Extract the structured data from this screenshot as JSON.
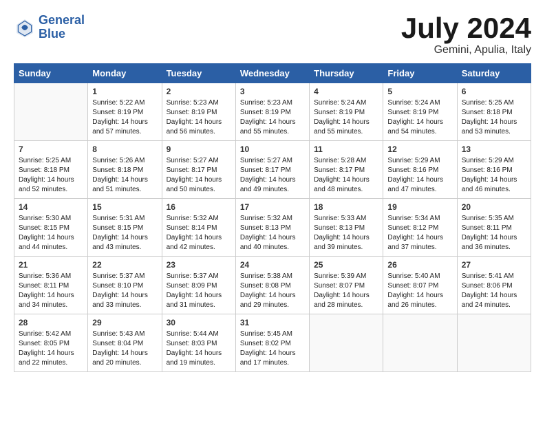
{
  "logo": {
    "text_general": "General",
    "text_blue": "Blue"
  },
  "header": {
    "month": "July 2024",
    "location": "Gemini, Apulia, Italy"
  },
  "weekdays": [
    "Sunday",
    "Monday",
    "Tuesday",
    "Wednesday",
    "Thursday",
    "Friday",
    "Saturday"
  ],
  "weeks": [
    [
      {
        "day": "",
        "info": ""
      },
      {
        "day": "1",
        "info": "Sunrise: 5:22 AM\nSunset: 8:19 PM\nDaylight: 14 hours\nand 57 minutes."
      },
      {
        "day": "2",
        "info": "Sunrise: 5:23 AM\nSunset: 8:19 PM\nDaylight: 14 hours\nand 56 minutes."
      },
      {
        "day": "3",
        "info": "Sunrise: 5:23 AM\nSunset: 8:19 PM\nDaylight: 14 hours\nand 55 minutes."
      },
      {
        "day": "4",
        "info": "Sunrise: 5:24 AM\nSunset: 8:19 PM\nDaylight: 14 hours\nand 55 minutes."
      },
      {
        "day": "5",
        "info": "Sunrise: 5:24 AM\nSunset: 8:19 PM\nDaylight: 14 hours\nand 54 minutes."
      },
      {
        "day": "6",
        "info": "Sunrise: 5:25 AM\nSunset: 8:18 PM\nDaylight: 14 hours\nand 53 minutes."
      }
    ],
    [
      {
        "day": "7",
        "info": "Sunrise: 5:25 AM\nSunset: 8:18 PM\nDaylight: 14 hours\nand 52 minutes."
      },
      {
        "day": "8",
        "info": "Sunrise: 5:26 AM\nSunset: 8:18 PM\nDaylight: 14 hours\nand 51 minutes."
      },
      {
        "day": "9",
        "info": "Sunrise: 5:27 AM\nSunset: 8:17 PM\nDaylight: 14 hours\nand 50 minutes."
      },
      {
        "day": "10",
        "info": "Sunrise: 5:27 AM\nSunset: 8:17 PM\nDaylight: 14 hours\nand 49 minutes."
      },
      {
        "day": "11",
        "info": "Sunrise: 5:28 AM\nSunset: 8:17 PM\nDaylight: 14 hours\nand 48 minutes."
      },
      {
        "day": "12",
        "info": "Sunrise: 5:29 AM\nSunset: 8:16 PM\nDaylight: 14 hours\nand 47 minutes."
      },
      {
        "day": "13",
        "info": "Sunrise: 5:29 AM\nSunset: 8:16 PM\nDaylight: 14 hours\nand 46 minutes."
      }
    ],
    [
      {
        "day": "14",
        "info": "Sunrise: 5:30 AM\nSunset: 8:15 PM\nDaylight: 14 hours\nand 44 minutes."
      },
      {
        "day": "15",
        "info": "Sunrise: 5:31 AM\nSunset: 8:15 PM\nDaylight: 14 hours\nand 43 minutes."
      },
      {
        "day": "16",
        "info": "Sunrise: 5:32 AM\nSunset: 8:14 PM\nDaylight: 14 hours\nand 42 minutes."
      },
      {
        "day": "17",
        "info": "Sunrise: 5:32 AM\nSunset: 8:13 PM\nDaylight: 14 hours\nand 40 minutes."
      },
      {
        "day": "18",
        "info": "Sunrise: 5:33 AM\nSunset: 8:13 PM\nDaylight: 14 hours\nand 39 minutes."
      },
      {
        "day": "19",
        "info": "Sunrise: 5:34 AM\nSunset: 8:12 PM\nDaylight: 14 hours\nand 37 minutes."
      },
      {
        "day": "20",
        "info": "Sunrise: 5:35 AM\nSunset: 8:11 PM\nDaylight: 14 hours\nand 36 minutes."
      }
    ],
    [
      {
        "day": "21",
        "info": "Sunrise: 5:36 AM\nSunset: 8:11 PM\nDaylight: 14 hours\nand 34 minutes."
      },
      {
        "day": "22",
        "info": "Sunrise: 5:37 AM\nSunset: 8:10 PM\nDaylight: 14 hours\nand 33 minutes."
      },
      {
        "day": "23",
        "info": "Sunrise: 5:37 AM\nSunset: 8:09 PM\nDaylight: 14 hours\nand 31 minutes."
      },
      {
        "day": "24",
        "info": "Sunrise: 5:38 AM\nSunset: 8:08 PM\nDaylight: 14 hours\nand 29 minutes."
      },
      {
        "day": "25",
        "info": "Sunrise: 5:39 AM\nSunset: 8:07 PM\nDaylight: 14 hours\nand 28 minutes."
      },
      {
        "day": "26",
        "info": "Sunrise: 5:40 AM\nSunset: 8:07 PM\nDaylight: 14 hours\nand 26 minutes."
      },
      {
        "day": "27",
        "info": "Sunrise: 5:41 AM\nSunset: 8:06 PM\nDaylight: 14 hours\nand 24 minutes."
      }
    ],
    [
      {
        "day": "28",
        "info": "Sunrise: 5:42 AM\nSunset: 8:05 PM\nDaylight: 14 hours\nand 22 minutes."
      },
      {
        "day": "29",
        "info": "Sunrise: 5:43 AM\nSunset: 8:04 PM\nDaylight: 14 hours\nand 20 minutes."
      },
      {
        "day": "30",
        "info": "Sunrise: 5:44 AM\nSunset: 8:03 PM\nDaylight: 14 hours\nand 19 minutes."
      },
      {
        "day": "31",
        "info": "Sunrise: 5:45 AM\nSunset: 8:02 PM\nDaylight: 14 hours\nand 17 minutes."
      },
      {
        "day": "",
        "info": ""
      },
      {
        "day": "",
        "info": ""
      },
      {
        "day": "",
        "info": ""
      }
    ]
  ]
}
